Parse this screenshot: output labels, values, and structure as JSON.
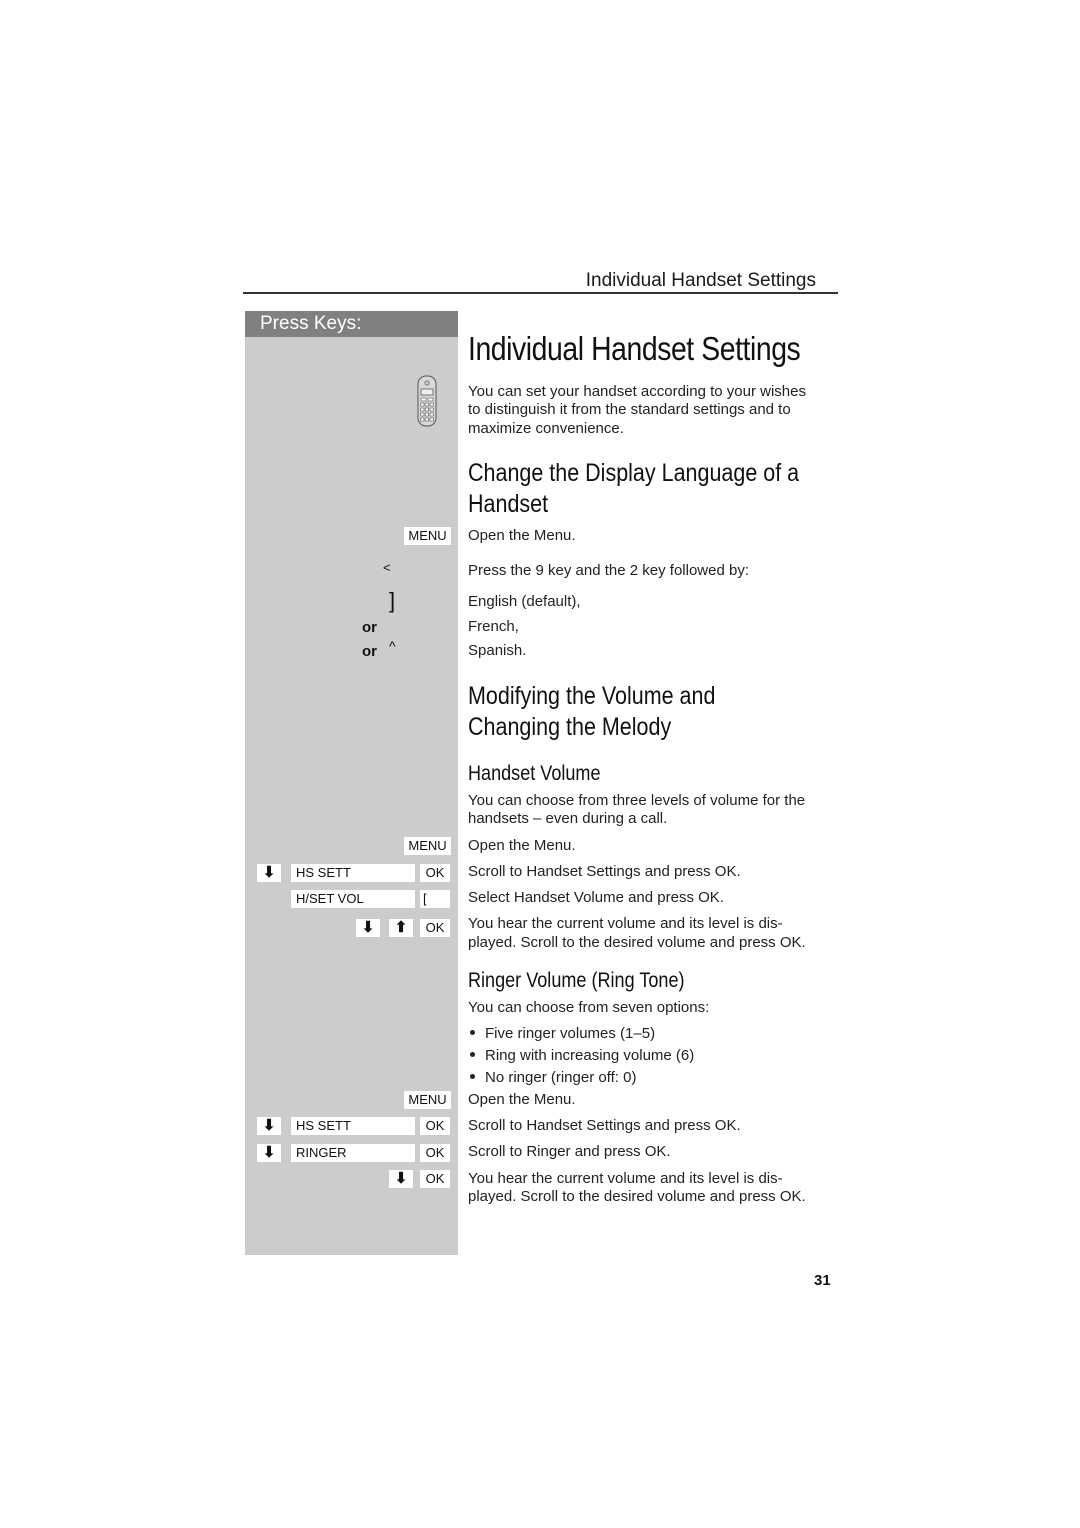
{
  "header": {
    "running_head": "Individual Handset Settings",
    "sidebar_title": "Press Keys:"
  },
  "main": {
    "title": "Individual Handset Settings",
    "intro": [
      "You can set your handset according to your wishes",
      "to distinguish it from the standard settings and to",
      "maximize convenience."
    ],
    "icons": {
      "handset": "handset-icon"
    }
  },
  "language_section": {
    "heading_line1": "Change the Display Language of a",
    "heading_line2": "Handset",
    "steps": [
      {
        "key": "MENU",
        "text": "Open the Menu."
      },
      {
        "key": "<",
        "text": "Press the 9 key and the 2 key followed by:"
      },
      {
        "key": "]",
        "text": "English (default),"
      },
      {
        "prefix": "or",
        "key": "",
        "text": "French,"
      },
      {
        "prefix": "or",
        "key": "^",
        "text": "Spanish."
      }
    ]
  },
  "volume_section": {
    "heading_line1": "Modifying the Volume and",
    "heading_line2": "Changing the Melody",
    "handset_volume": {
      "heading": "Handset Volume",
      "intro": [
        "You can choose from three levels of volume for the",
        "handsets  –  even during a call."
      ],
      "steps": [
        {
          "keys": [
            "MENU"
          ],
          "text": [
            "Open the Menu."
          ]
        },
        {
          "arrow": "down",
          "display": "HS SETT",
          "keys": [
            "OK"
          ],
          "text": [
            "Scroll to Handset Settings and press OK."
          ]
        },
        {
          "display": "H/SET VOL",
          "keys": [
            "["
          ],
          "text": [
            "Select Handset Volume and press OK."
          ]
        },
        {
          "arrows": [
            "down",
            "up"
          ],
          "keys": [
            "OK"
          ],
          "text": [
            "You hear the current volume and its level is dis-",
            "played. Scroll to the desired volume and press OK."
          ]
        }
      ]
    },
    "ringer_volume": {
      "heading": "Ringer Volume (Ring Tone)",
      "intro": "You can choose from seven options:",
      "bullets": [
        "Five ringer volumes (1–5)",
        "Ring with increasing volume (6)",
        "No ringer (ringer off: 0)"
      ],
      "steps": [
        {
          "keys": [
            "MENU"
          ],
          "text": [
            "Open the Menu."
          ]
        },
        {
          "arrow": "down",
          "display": "HS SETT",
          "keys": [
            "OK"
          ],
          "text": [
            "Scroll to Handset Settings and press OK."
          ]
        },
        {
          "arrow": "down",
          "display": "RINGER",
          "keys": [
            "OK"
          ],
          "text": [
            "Scroll to Ringer and press OK."
          ]
        },
        {
          "arrow": "down",
          "keys": [
            "OK"
          ],
          "text": [
            "You hear the current volume and its level is dis-",
            "played. Scroll to the desired volume and press OK."
          ]
        }
      ]
    }
  },
  "glyphs": {
    "arrow_down": "⬇",
    "arrow_up": "⬆"
  },
  "footer": {
    "page_number": "31"
  }
}
